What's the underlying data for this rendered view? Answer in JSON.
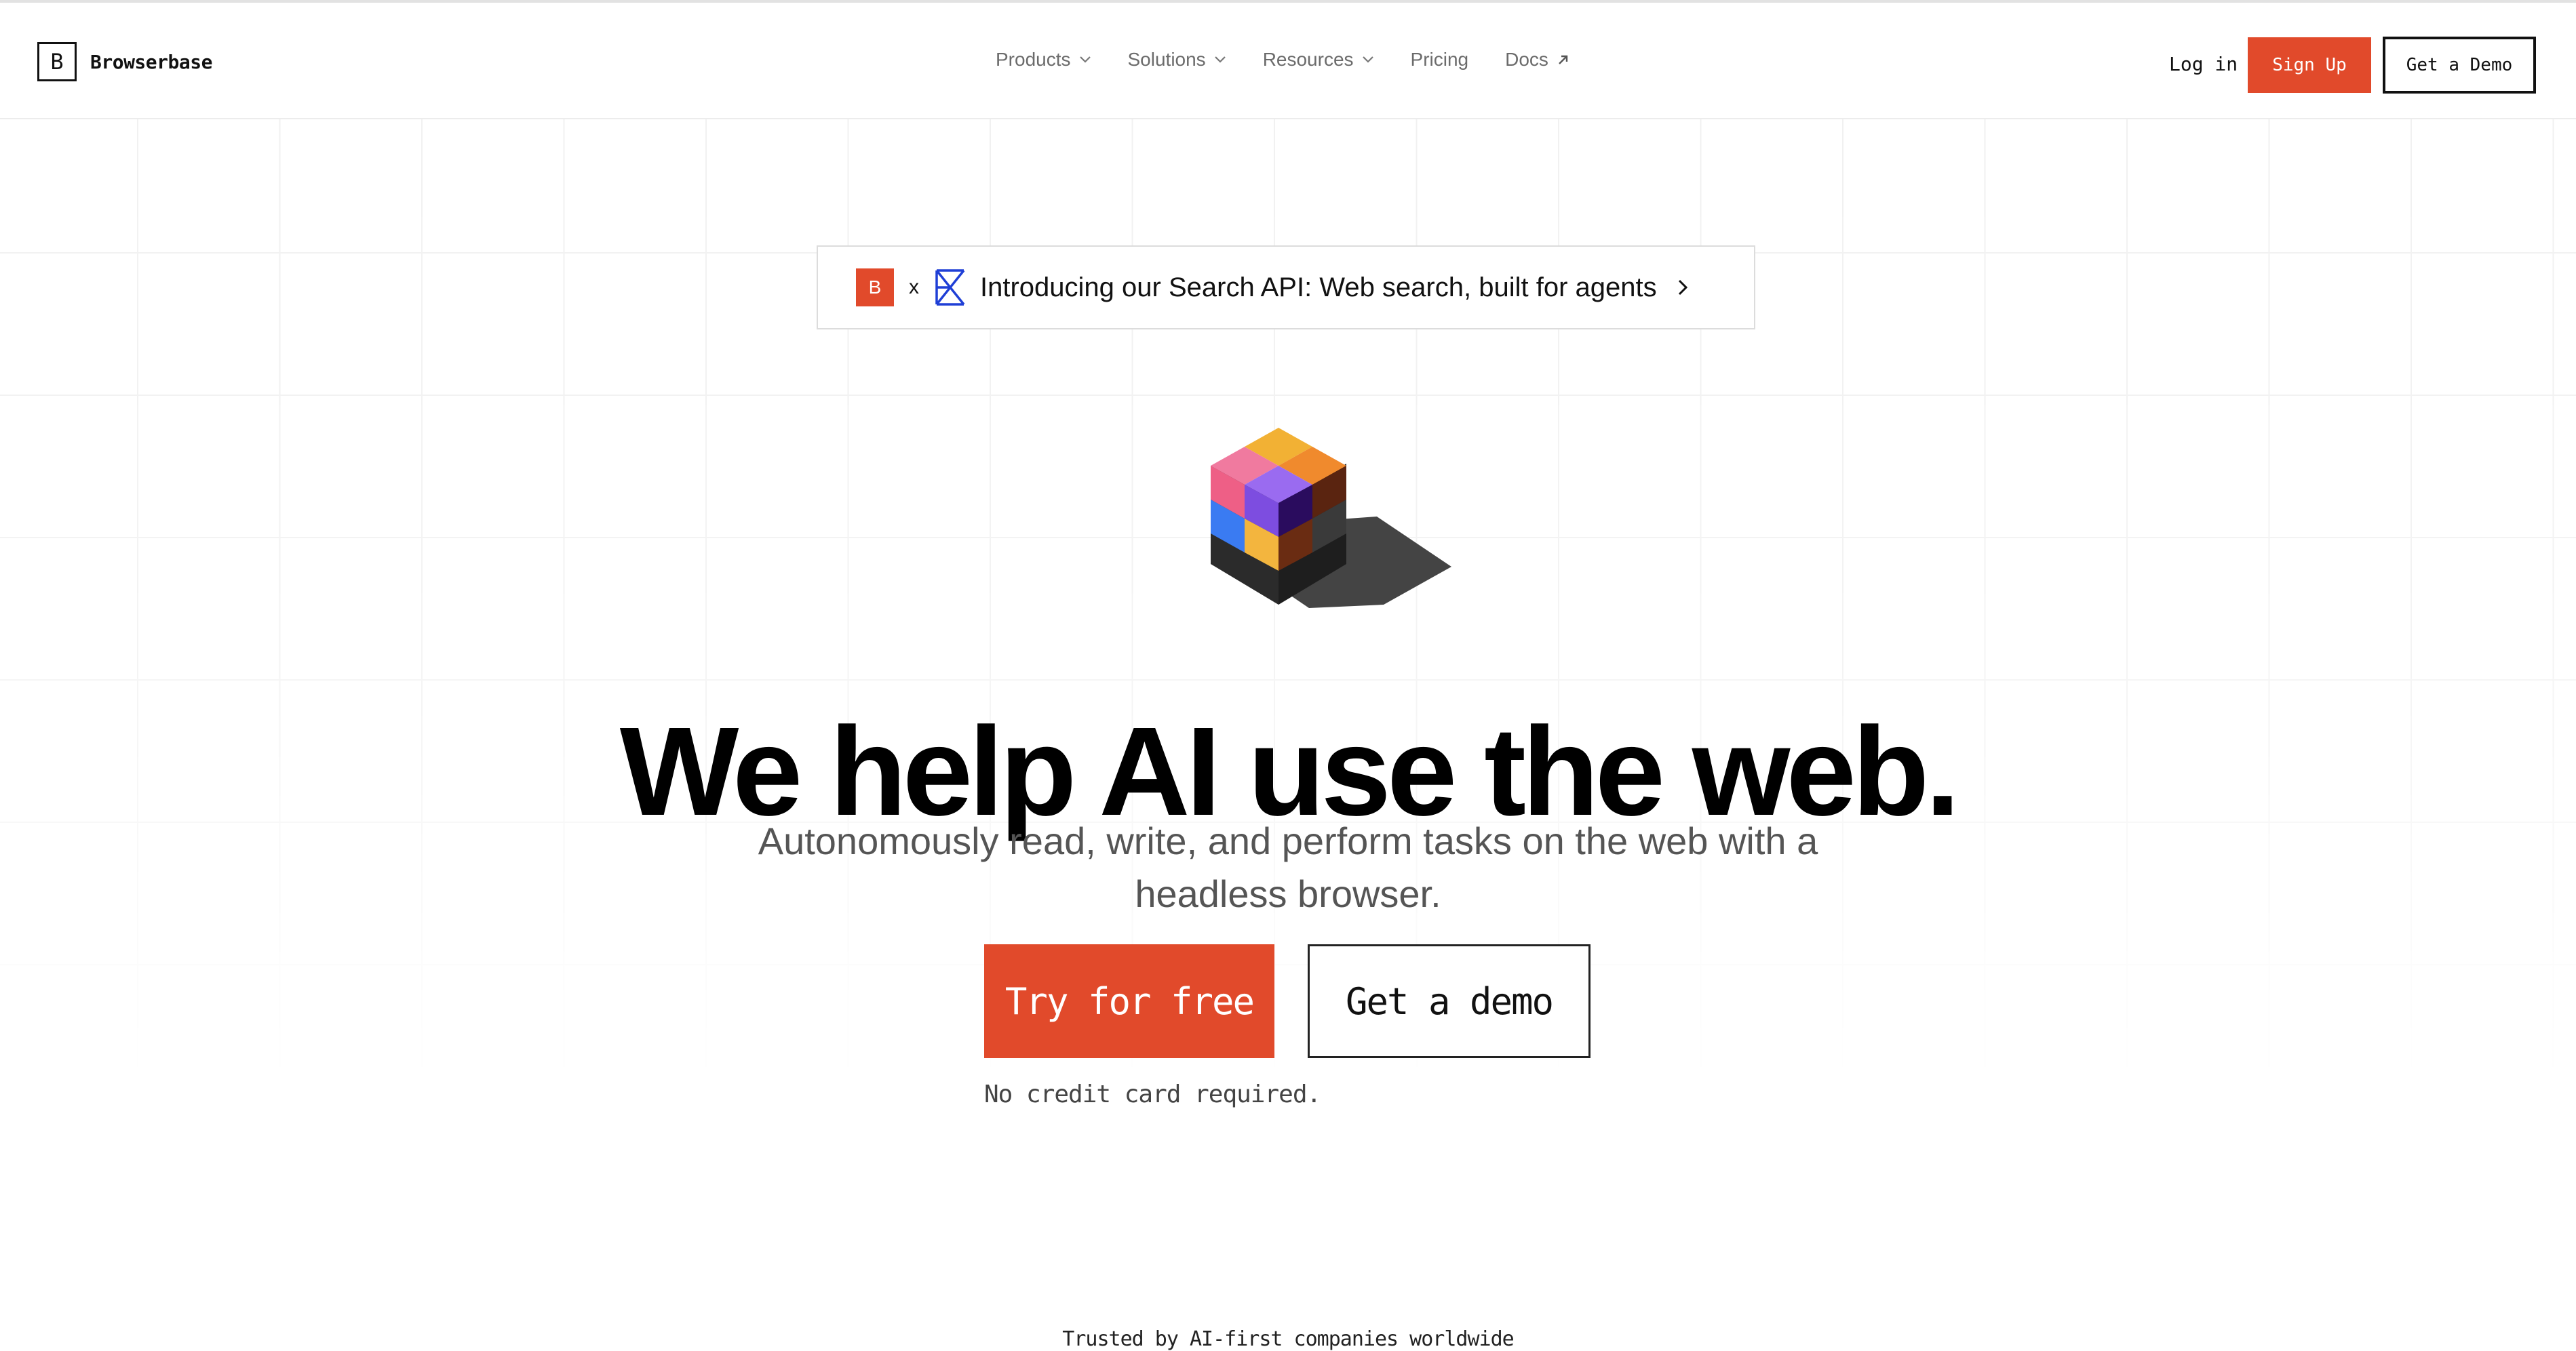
{
  "brand": {
    "logo_letter": "B",
    "name": "Browserbase"
  },
  "nav": {
    "items": [
      {
        "label": "Products",
        "icon": "chevron-down-icon"
      },
      {
        "label": "Solutions",
        "icon": "chevron-down-icon"
      },
      {
        "label": "Resources",
        "icon": "chevron-down-icon"
      },
      {
        "label": "Pricing"
      },
      {
        "label": "Docs",
        "icon": "arrow-up-right-icon"
      }
    ],
    "login": "Log in",
    "signup": "Sign Up",
    "demo": "Get a Demo"
  },
  "banner": {
    "badge_letter": "B",
    "times": "x",
    "text": "Introducing our Search API: Web search, built for agents"
  },
  "hero": {
    "headline": "We help AI use the web.",
    "subhead": "Autonomously read, write, and perform tasks on the web with a headless browser.",
    "primary_cta": "Try for free",
    "secondary_cta": "Get a demo",
    "note": "No credit card required."
  },
  "trusted": "Trusted by AI-first companies worldwide",
  "colors": {
    "accent": "#e14a2b",
    "text": "#111111",
    "muted": "#555555",
    "grid": "#f1f1f1"
  }
}
